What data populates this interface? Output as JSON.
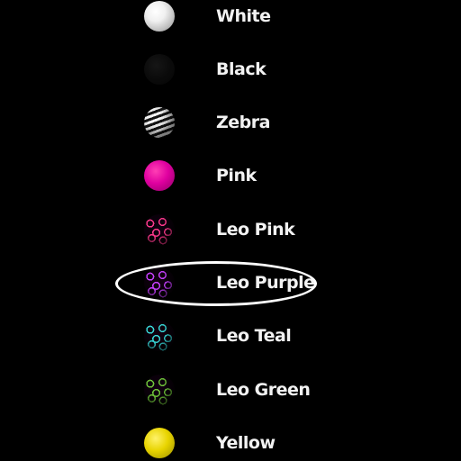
{
  "items": [
    {
      "label": "White",
      "icon": "white-ball-icon",
      "color": "#f0f0f0"
    },
    {
      "label": "Black",
      "icon": "black-ball-icon",
      "color": "#0b0b0b"
    },
    {
      "label": "Zebra",
      "icon": "zebra-ball-icon",
      "color": "#f5f5f5"
    },
    {
      "label": "Pink",
      "icon": "pink-ball-icon",
      "color": "#e000a0"
    },
    {
      "label": "Leo Pink",
      "icon": "leopard-pink-ball-icon",
      "color": "#ff3a8c"
    },
    {
      "label": "Leo Purple",
      "icon": "leopard-purple-ball-icon",
      "color": "#c640ff"
    },
    {
      "label": "Leo Teal",
      "icon": "leopard-teal-ball-icon",
      "color": "#38d6d6"
    },
    {
      "label": "Leo Green",
      "icon": "leopard-green-ball-icon",
      "color": "#6fc43a"
    },
    {
      "label": "Yellow",
      "icon": "yellow-ball-icon",
      "color": "#e8d400"
    }
  ],
  "selected": "Leo Purple"
}
